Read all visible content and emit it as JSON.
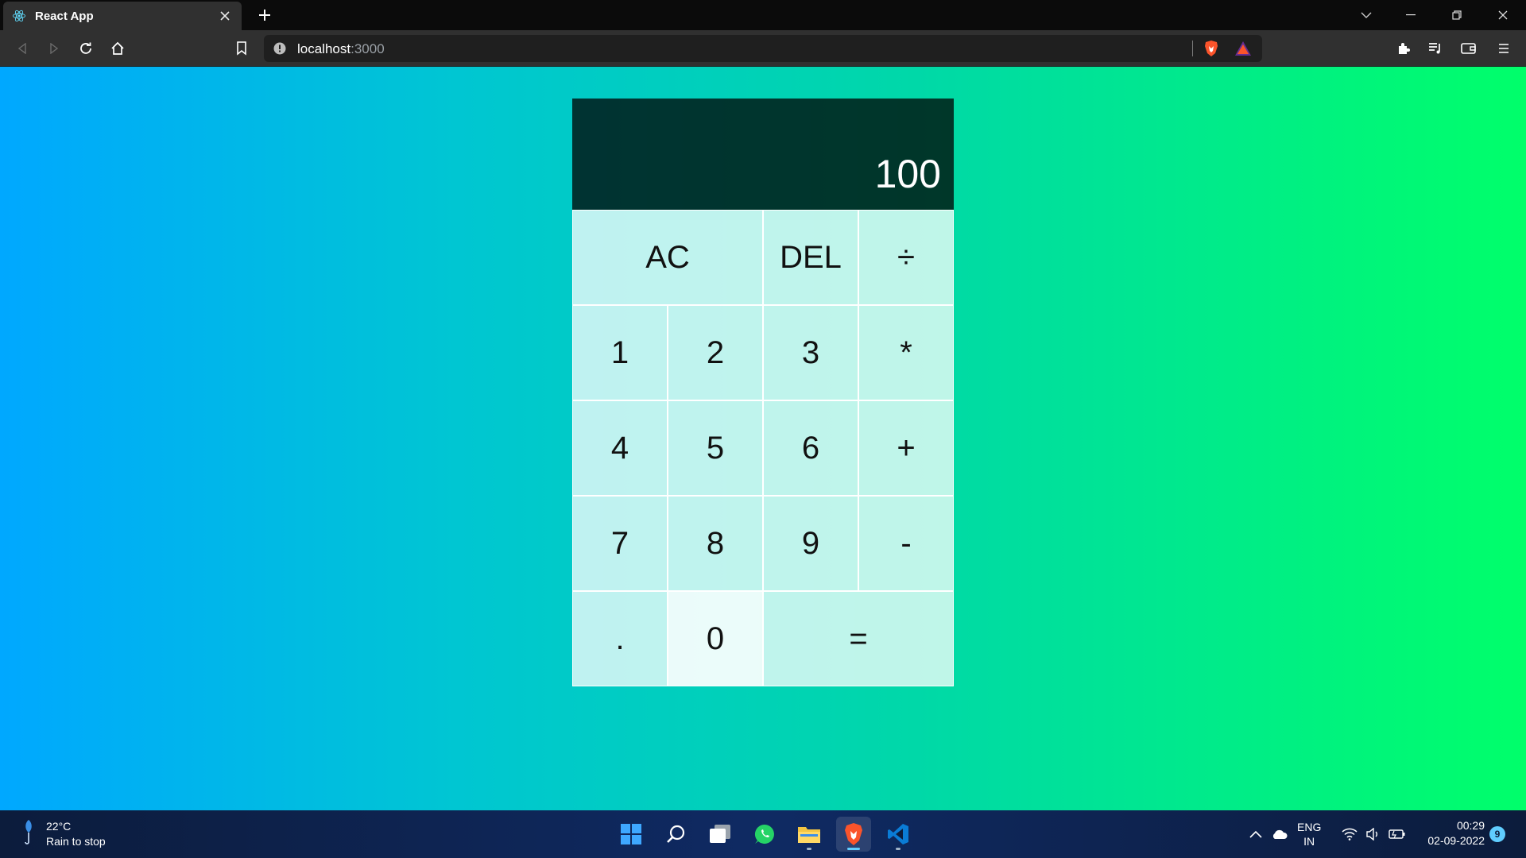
{
  "browser": {
    "tab_title": "React App",
    "url_host": "localhost",
    "url_port": ":3000"
  },
  "calculator": {
    "previous_operand": "",
    "current_operand": "100",
    "keys": {
      "ac": "AC",
      "del": "DEL",
      "divide": "÷",
      "one": "1",
      "two": "2",
      "three": "3",
      "multiply": "*",
      "four": "4",
      "five": "5",
      "six": "6",
      "plus": "+",
      "seven": "7",
      "eight": "8",
      "nine": "9",
      "minus": "-",
      "dot": ".",
      "zero": "0",
      "equals": "="
    }
  },
  "taskbar": {
    "weather_temp": "22°C",
    "weather_desc": "Rain to stop",
    "apps": [
      "start-icon",
      "search-icon",
      "task-view-icon",
      "whatsapp-icon",
      "file-explorer-icon",
      "brave-icon",
      "vscode-icon"
    ],
    "lang_line1": "ENG",
    "lang_line2": "IN",
    "time": "00:29",
    "date": "02-09-2022",
    "notification_count": "9"
  },
  "colors": {
    "gradient_start": "#00a8ff",
    "gradient_end": "#00ff6a",
    "display_bg": "#012f2c",
    "key_bg": "#c2f0ea"
  }
}
